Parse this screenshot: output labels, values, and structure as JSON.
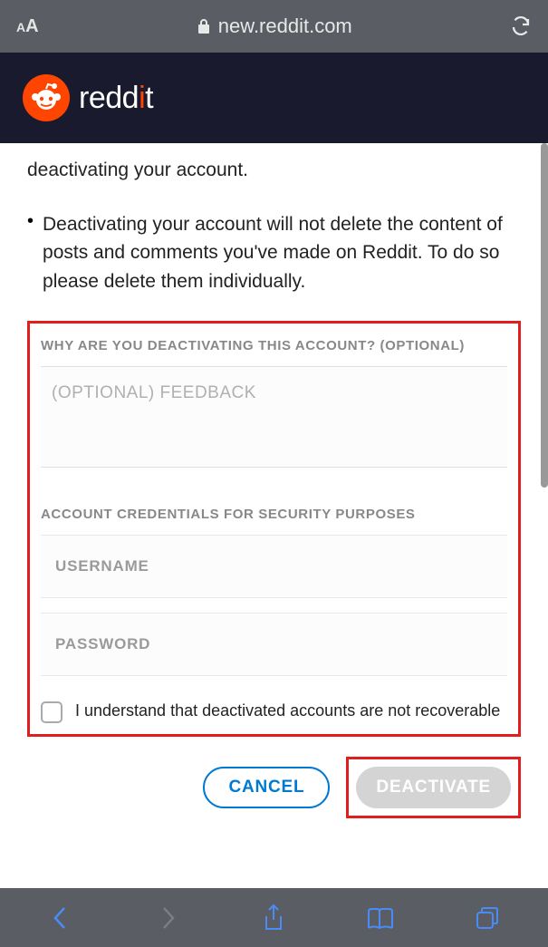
{
  "browser": {
    "url": "new.reddit.com"
  },
  "header": {
    "brand_pre": "redd",
    "brand_accent": "i",
    "brand_post": "t"
  },
  "content": {
    "partial_line": "deactivating your account.",
    "bullet_text": "Deactivating your account will not delete the content of posts and comments you've made on Reddit. To do so please delete them individually.",
    "feedback_label": "WHY ARE YOU DEACTIVATING THIS ACCOUNT? (OPTIONAL)",
    "feedback_placeholder": "(OPTIONAL) FEEDBACK",
    "credentials_label": "ACCOUNT CREDENTIALS FOR SECURITY PURPOSES",
    "username_placeholder": "USERNAME",
    "password_placeholder": "PASSWORD",
    "checkbox_label": "I understand that deactivated accounts are not recoverable",
    "cancel_label": "CANCEL",
    "deactivate_label": "DEACTIVATE"
  }
}
